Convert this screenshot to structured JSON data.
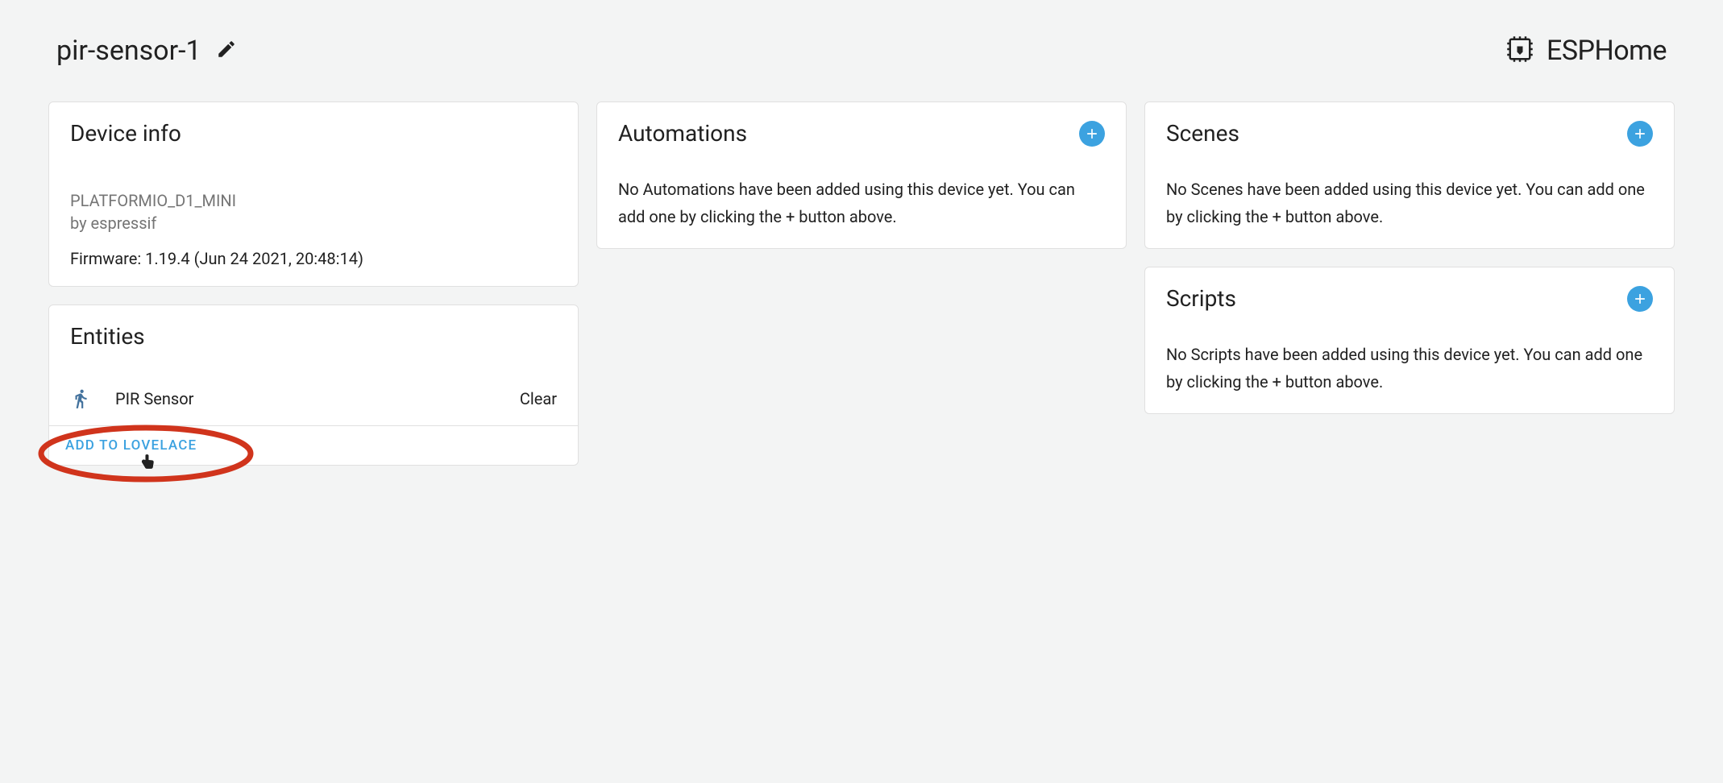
{
  "header": {
    "device_name": "pir-sensor-1",
    "brand_name": "ESPHome"
  },
  "device_info": {
    "title": "Device info",
    "platform": "PLATFORMIO_D1_MINI",
    "by": "by espressif",
    "firmware": "Firmware: 1.19.4 (Jun 24 2021, 20:48:14)"
  },
  "entities": {
    "title": "Entities",
    "items": [
      {
        "name": "PIR Sensor",
        "state": "Clear"
      }
    ],
    "action": "ADD TO LOVELACE"
  },
  "automations": {
    "title": "Automations",
    "empty_text": "No Automations have been added using this device yet. You can add one by clicking the + button above."
  },
  "scenes": {
    "title": "Scenes",
    "empty_text": "No Scenes have been added using this device yet. You can add one by clicking the + button above."
  },
  "scripts": {
    "title": "Scripts",
    "empty_text": "No Scripts have been added using this device yet. You can add one by clicking the + button above."
  }
}
